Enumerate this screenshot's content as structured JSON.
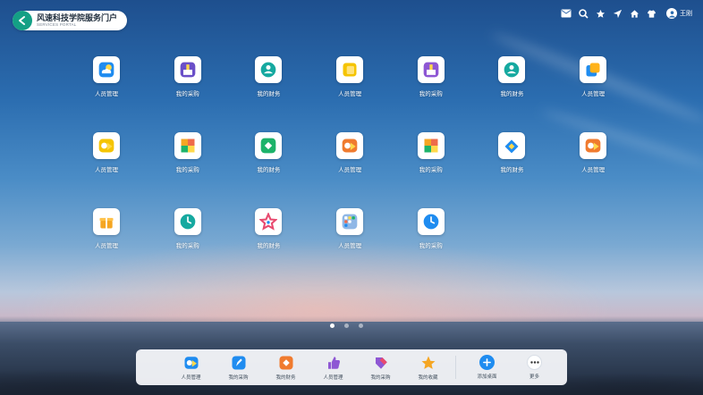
{
  "portal": {
    "title": "风速科技学院服务门户",
    "subtitle": "SERVICES PORTAL",
    "accent": "#14a085"
  },
  "toolbar": {
    "icons": [
      "mail-icon",
      "search-icon",
      "star-icon",
      "send-icon",
      "home-icon",
      "shirt-icon"
    ],
    "user_name": "王刚"
  },
  "apps": [
    {
      "label": "人员管理",
      "icon": "cloud-sun-icon",
      "color": "#1f8cf0"
    },
    {
      "label": "我的采购",
      "icon": "brush-icon",
      "color": "#6a4fc8"
    },
    {
      "label": "我的财务",
      "icon": "person-icon",
      "color": "#16a9a0"
    },
    {
      "label": "人员管理",
      "icon": "note-icon",
      "color": "#f5c400"
    },
    {
      "label": "我的采购",
      "icon": "brush-icon",
      "color": "#8e57d4"
    },
    {
      "label": "我的财务",
      "icon": "person-icon",
      "color": "#16a9a0"
    },
    {
      "label": "人员管理",
      "icon": "layers-icon",
      "color": "#1f8cf0"
    },
    {
      "label": "人员管理",
      "icon": "gamepad-icon",
      "color": "#f5c400"
    },
    {
      "label": "我的采购",
      "icon": "blocks-icon",
      "color": "#ee6b4a"
    },
    {
      "label": "我的财务",
      "icon": "diamond-icon",
      "color": "#1db36a"
    },
    {
      "label": "人员管理",
      "icon": "gamepad-icon",
      "color": "#f07b2f"
    },
    {
      "label": "我的采购",
      "icon": "blocks-icon",
      "color": "#ee6b4a"
    },
    {
      "label": "我的财务",
      "icon": "chevron-tile-icon",
      "color": "#1f8cf0"
    },
    {
      "label": "人员管理",
      "icon": "gamepad-icon",
      "color": "#f07b2f"
    },
    {
      "label": "人员管理",
      "icon": "gift-icon",
      "color": "#f5a623"
    },
    {
      "label": "我的采购",
      "icon": "clock-icon",
      "color": "#16a9a0"
    },
    {
      "label": "我的财务",
      "icon": "star-outline-icon",
      "color": "#e84a6f"
    },
    {
      "label": "人员管理",
      "icon": "folder-icon",
      "color": "#8fb7e6"
    },
    {
      "label": "我的采购",
      "icon": "clock-icon",
      "color": "#1f8cf0"
    }
  ],
  "pager": {
    "pages": 3,
    "current": 1
  },
  "dock": {
    "items": [
      {
        "label": "人员管理",
        "icon": "gamepad-icon",
        "color": "#1f8cf0"
      },
      {
        "label": "我的采购",
        "icon": "pen-icon",
        "color": "#1f8cf0"
      },
      {
        "label": "我的财务",
        "icon": "diamond-icon",
        "color": "#f07b2f"
      },
      {
        "label": "人员管理",
        "icon": "thumbs-up-icon",
        "color": "#8e57d4"
      },
      {
        "label": "我的采购",
        "icon": "tag-icon",
        "color": "#8e57d4"
      },
      {
        "label": "我的收藏",
        "icon": "star-icon",
        "color": "#f5a623"
      }
    ],
    "add_label": "添加桌面",
    "more_label": "更多"
  }
}
